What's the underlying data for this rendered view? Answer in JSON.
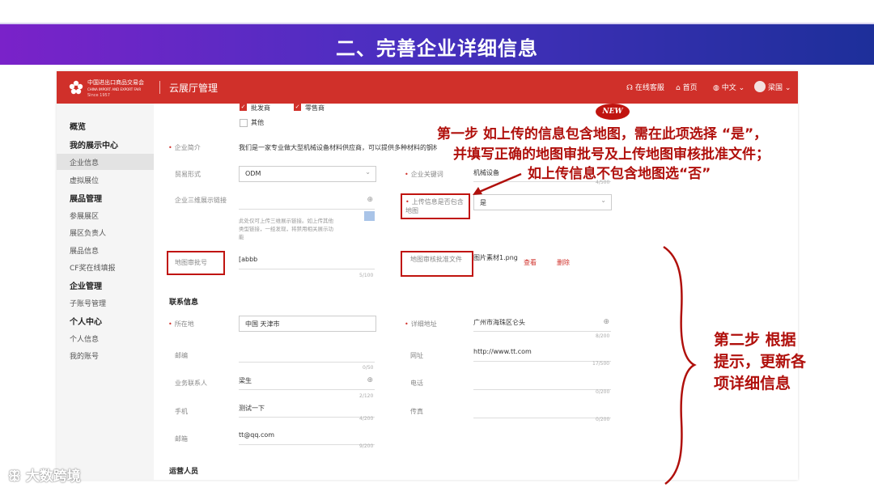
{
  "banner": {
    "title": "二、完善企业详细信息"
  },
  "header": {
    "logo_line1": "中国进出口商品交易会",
    "logo_line2": "CHINA IMPORT AND EXPORT FAIR",
    "logo_line3": "Since 1957",
    "app_title": "云展厅管理",
    "support": "在线客服",
    "home": "首页",
    "language": "中文",
    "user": "梁国"
  },
  "sidebar": {
    "overview": "概览",
    "group_showcase": "我的展示中心",
    "item_company_info": "企业信息",
    "item_virtual_booth": "虚拟展位",
    "group_exhibit": "展品管理",
    "item_exhibit_area": "参展展区",
    "item_area_manager": "展区负责人",
    "item_exhibit_info": "展品信息",
    "item_cf_award": "CF奖在线填报",
    "group_company": "企业管理",
    "item_sub_account": "子账号管理",
    "group_personal": "个人中心",
    "item_personal_info": "个人信息",
    "item_my_account": "我的账号"
  },
  "form": {
    "type_wholesaler": "批发商",
    "type_retailer": "零售商",
    "type_other": "其他",
    "intro_label": "企业简介",
    "intro_value": "我们是一家专业做大型机械设备材料供应商，可以提供多种材料的钢材，欢迎...",
    "trade_label": "贸易形式",
    "trade_value": "ODM",
    "keyword_label": "企业关键词",
    "keyword_value": "机械设备",
    "keyword_counter": "4/500",
    "link3d_label": "企业三维展示链接",
    "link3d_hint": "此处仅可上传三维展示链接。如上传其他类型链接，一经发现，将禁用相关展示功能",
    "map_question_label": "上传信息是否包含地图",
    "map_question_value": "是",
    "map_approval_label": "地图审批号",
    "map_approval_value": "[abbb",
    "map_approval_counter": "5/100",
    "map_file_label": "地图审核批准文件",
    "map_file_name": "图片素材1.png",
    "map_file_view": "查看",
    "map_file_delete": "删除"
  },
  "contact": {
    "section_title": "联系信息",
    "location_label": "所在地",
    "location_value": "中国 天津市",
    "address_label": "详细地址",
    "address_value": "广州市海珠区仑头",
    "address_counter": "8/200",
    "zip_label": "邮编",
    "zip_counter": "0/50",
    "website_label": "网址",
    "website_value": "http://www.tt.com",
    "website_counter": "17/500",
    "contact_label": "业务联系人",
    "contact_value": "梁生",
    "contact_counter": "2/120",
    "phone_label": "电话",
    "phone_counter": "0/200",
    "mobile_label": "手机",
    "mobile_value": "测试一下",
    "mobile_counter": "4/200",
    "fax_label": "传真",
    "fax_counter": "0/200",
    "email_label": "邮箱",
    "email_value": "tt@qq.com",
    "email_counter": "9/200",
    "operator_section": "运营人员"
  },
  "annotations": {
    "new_badge": "NEW",
    "step1_line1": "第一步  如上传的信息包含地图，需在此项选择  “是”，",
    "step1_line2": "并填写正确的地图审批号及上传地图审核批准文件；",
    "step1_line3": "如上传信息不包含地图选“否”",
    "step2_line1": "第二步   根据",
    "step2_line2": "提示，更新各",
    "step2_line3": "项详细信息"
  },
  "watermark": {
    "text": "大数跨境"
  },
  "colors": {
    "brand_red": "#d0302a",
    "annotation_red": "#b0100c",
    "banner_start": "#7a22c9",
    "banner_end": "#1d2f9a"
  }
}
